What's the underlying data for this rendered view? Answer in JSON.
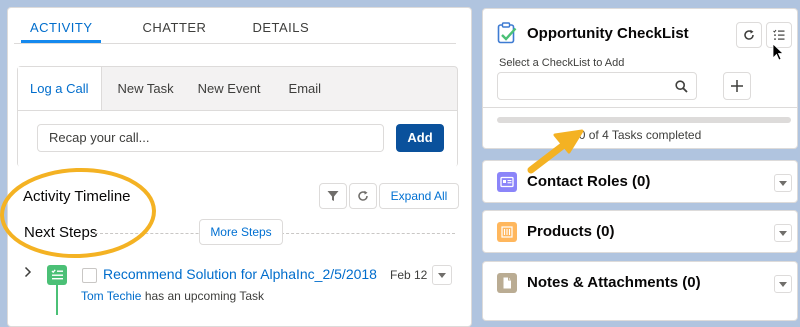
{
  "left": {
    "tabs": [
      {
        "label": "ACTIVITY"
      },
      {
        "label": "CHATTER"
      },
      {
        "label": "DETAILS"
      }
    ],
    "composer": {
      "tabs": [
        {
          "label": "Log a Call"
        },
        {
          "label": "New Task"
        },
        {
          "label": "New Event"
        },
        {
          "label": "Email"
        }
      ],
      "placeholder": "Recap your call...",
      "add_label": "Add"
    },
    "timeline": {
      "title": "Activity Timeline",
      "expand_label": "Expand All",
      "next_steps": "Next Steps",
      "more_steps_label": "More Steps"
    },
    "task": {
      "title": "Recommend Solution for AlphaInc_2/5/2018",
      "date": "Feb 12",
      "owner": "Tom Techie",
      "status_text": "has an upcoming Task"
    }
  },
  "right": {
    "checklist": {
      "title": "Opportunity CheckList",
      "select_label": "Select a CheckList to Add",
      "progress_fraction": 0,
      "progress_text": "0 of 4 Tasks completed"
    },
    "related": [
      {
        "title": "Contact Roles (0)",
        "icon": "contact-card-icon",
        "color": "#8b85f9"
      },
      {
        "title": "Products (0)",
        "icon": "products-icon",
        "color": "#ffb75d"
      },
      {
        "title": "Notes & Attachments (0)",
        "icon": "notes-icon",
        "color": "#baac93"
      }
    ]
  },
  "colors": {
    "accent": "#0070d2",
    "brand_button": "#0a519c",
    "annotation": "#f4b223",
    "task_green": "#4bc076",
    "background": "#b0c4df"
  }
}
